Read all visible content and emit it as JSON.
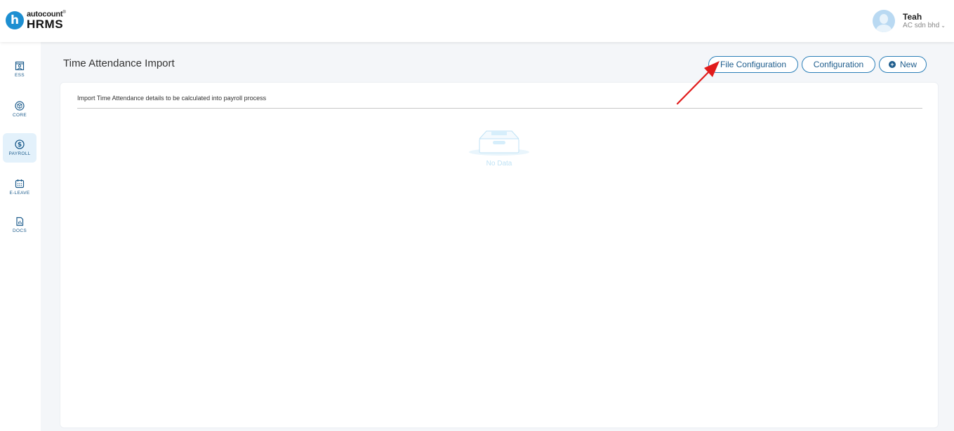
{
  "app": {
    "logo_top": "autocount",
    "logo_bottom": "HRMS"
  },
  "user": {
    "name": "Teah",
    "company": "AC sdn bhd"
  },
  "sidebar": {
    "items": [
      {
        "label": "ESS",
        "icon": "ess-icon"
      },
      {
        "label": "CORE",
        "icon": "core-icon"
      },
      {
        "label": "PAYROLL",
        "icon": "payroll-icon",
        "active": true
      },
      {
        "label": "E-LEAVE",
        "icon": "calendar-icon"
      },
      {
        "label": "DOCS",
        "icon": "docs-icon"
      }
    ]
  },
  "page": {
    "title": "Time Attendance Import",
    "description": "Import Time Attendance details to be calculated into payroll process",
    "empty_text": "No Data"
  },
  "toolbar": {
    "file_configuration": "File Configuration",
    "configuration": "Configuration",
    "new": "New"
  },
  "colors": {
    "accent": "#1d8fd1",
    "button_border": "#2b7fb8",
    "annotation_arrow": "#e11b1b"
  }
}
